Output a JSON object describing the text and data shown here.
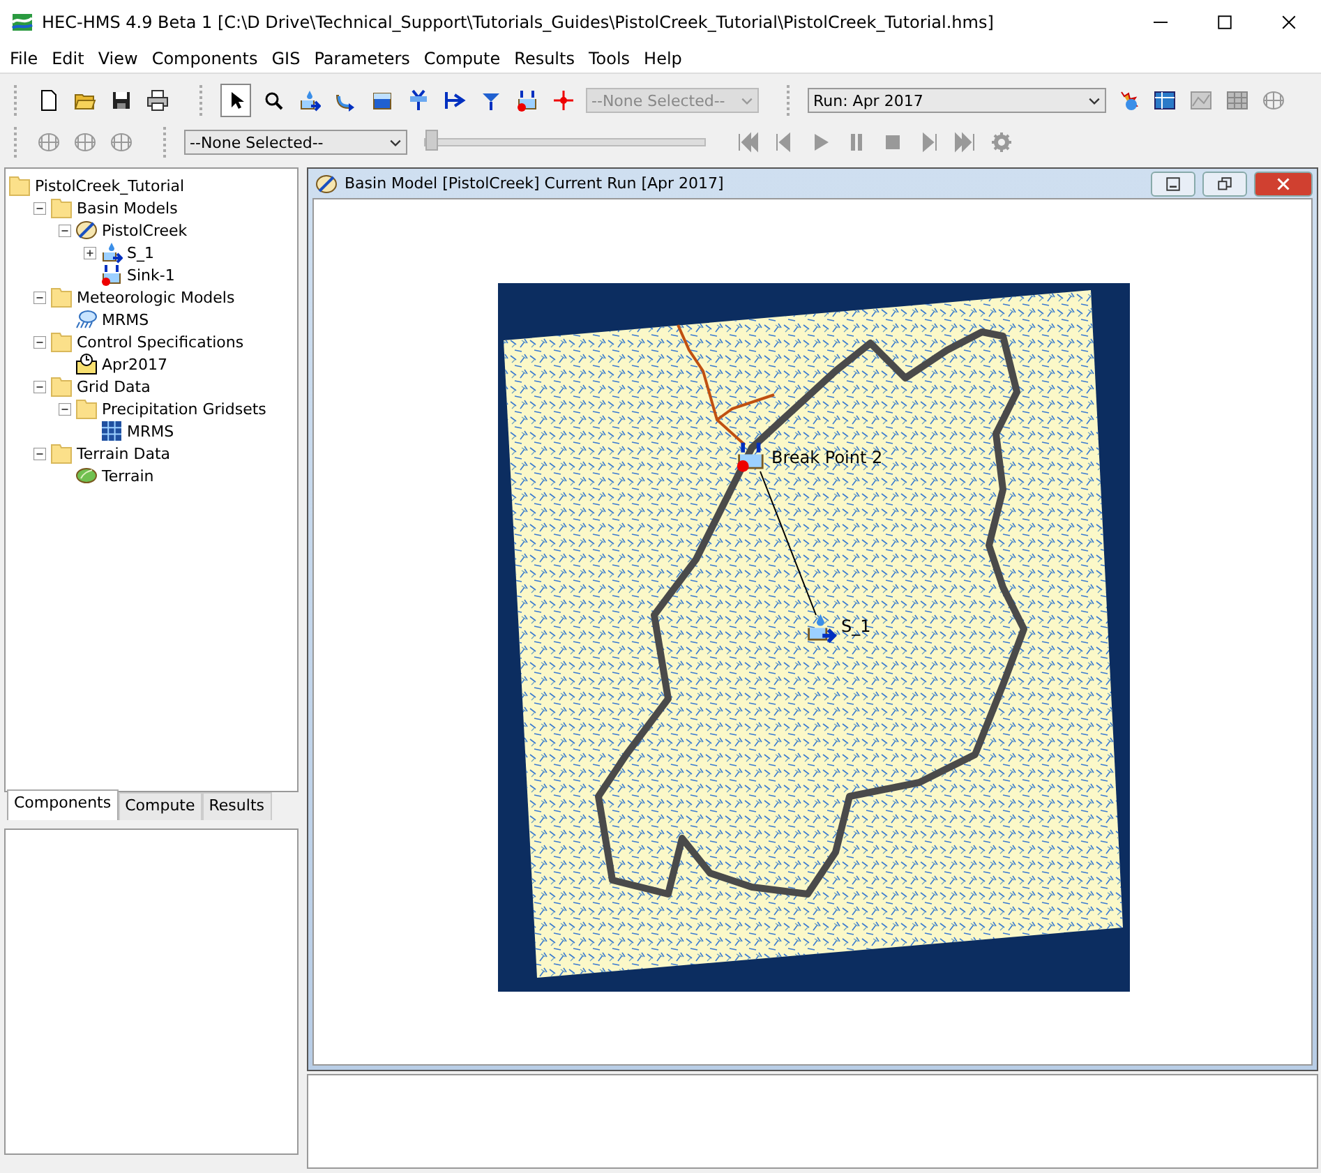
{
  "window": {
    "title": "HEC-HMS 4.9 Beta 1 [C:\\D Drive\\Technical_Support\\Tutorials_Guides\\PistolCreek_Tutorial\\PistolCreek_Tutorial.hms]"
  },
  "menu": [
    "File",
    "Edit",
    "View",
    "Components",
    "GIS",
    "Parameters",
    "Compute",
    "Results",
    "Tools",
    "Help"
  ],
  "toolbar": {
    "element_selector": {
      "value": "--None Selected--",
      "disabled": true
    },
    "run_selector": {
      "value": "Run: Apr 2017",
      "disabled": false
    }
  },
  "animation_bar": {
    "grid_selector": {
      "value": "--None Selected--"
    },
    "time_slider": {
      "level": 0
    }
  },
  "tree": [
    {
      "label": "PistolCreek_Tutorial",
      "kind": "folder",
      "children": [
        {
          "label": "Basin Models",
          "kind": "folder",
          "expanded": true,
          "children": [
            {
              "label": "PistolCreek",
              "kind": "basin",
              "expanded": true,
              "children": [
                {
                  "label": "S_1",
                  "kind": "subbasin",
                  "expanded": false
                },
                {
                  "label": "Sink-1",
                  "kind": "sink"
                }
              ]
            }
          ]
        },
        {
          "label": "Meteorologic Models",
          "kind": "folder",
          "expanded": true,
          "children": [
            {
              "label": "MRMS",
              "kind": "met"
            }
          ]
        },
        {
          "label": "Control Specifications",
          "kind": "folder",
          "expanded": true,
          "children": [
            {
              "label": "Apr2017",
              "kind": "control"
            }
          ]
        },
        {
          "label": "Grid Data",
          "kind": "folder",
          "expanded": true,
          "children": [
            {
              "label": "Precipitation Gridsets",
              "kind": "folder",
              "expanded": true,
              "children": [
                {
                  "label": "MRMS",
                  "kind": "gridset"
                }
              ]
            }
          ]
        },
        {
          "label": "Terrain Data",
          "kind": "folder",
          "expanded": true,
          "children": [
            {
              "label": "Terrain",
              "kind": "terrain"
            }
          ]
        }
      ]
    }
  ],
  "tabs": [
    {
      "label": "Components",
      "selected": true
    },
    {
      "label": "Compute",
      "selected": false
    },
    {
      "label": "Results",
      "selected": false
    }
  ],
  "basin_window": {
    "title": "Basin Model [PistolCreek] Current Run [Apr 2017]",
    "map_elements": [
      {
        "kind": "sink",
        "label": "Break Point 2"
      },
      {
        "kind": "subbasin",
        "label": "S_1"
      }
    ]
  }
}
